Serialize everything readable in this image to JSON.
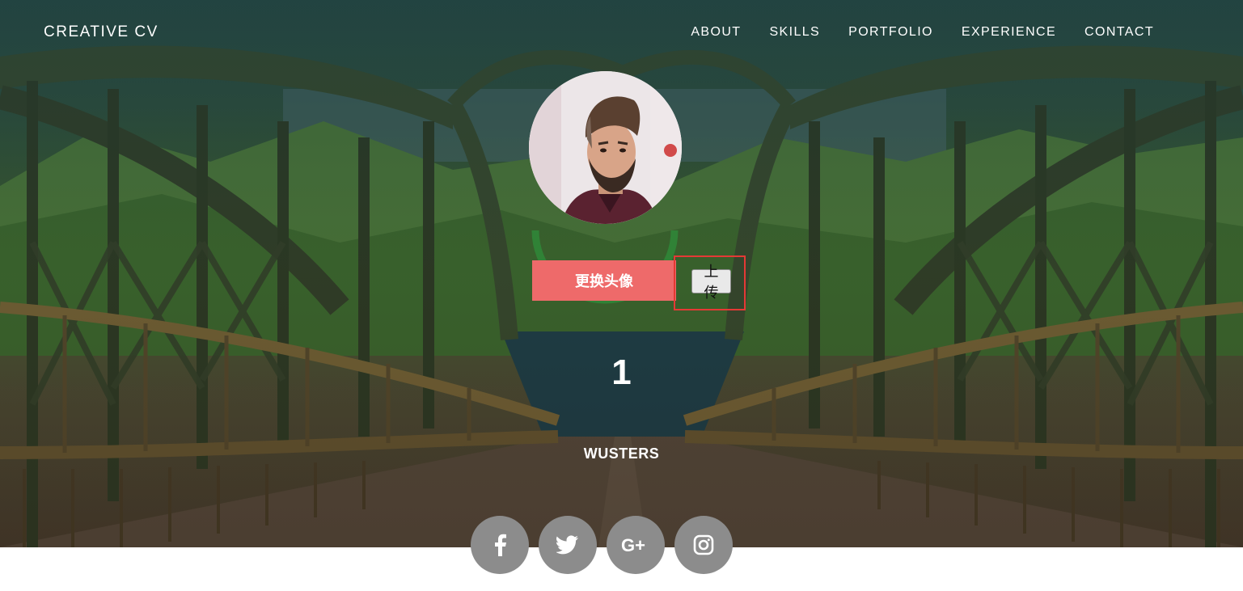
{
  "nav": {
    "brand": "CREATIVE CV",
    "items": [
      {
        "label": "ABOUT"
      },
      {
        "label": "SKILLS"
      },
      {
        "label": "PORTFOLIO"
      },
      {
        "label": "EXPERIENCE"
      },
      {
        "label": "CONTACT"
      }
    ]
  },
  "profile": {
    "change_avatar_label": "更换头像",
    "upload_label": "上传",
    "count": "1",
    "name": "WUSTERS"
  },
  "social": [
    {
      "icon": "facebook-icon"
    },
    {
      "icon": "twitter-icon"
    },
    {
      "icon": "google-plus-icon"
    },
    {
      "icon": "instagram-icon"
    }
  ],
  "colors": {
    "accent": "#ee6a6a",
    "highlight_border": "#e53935",
    "social_bg": "#8c8c8c",
    "ring": "#2e8b3a"
  }
}
